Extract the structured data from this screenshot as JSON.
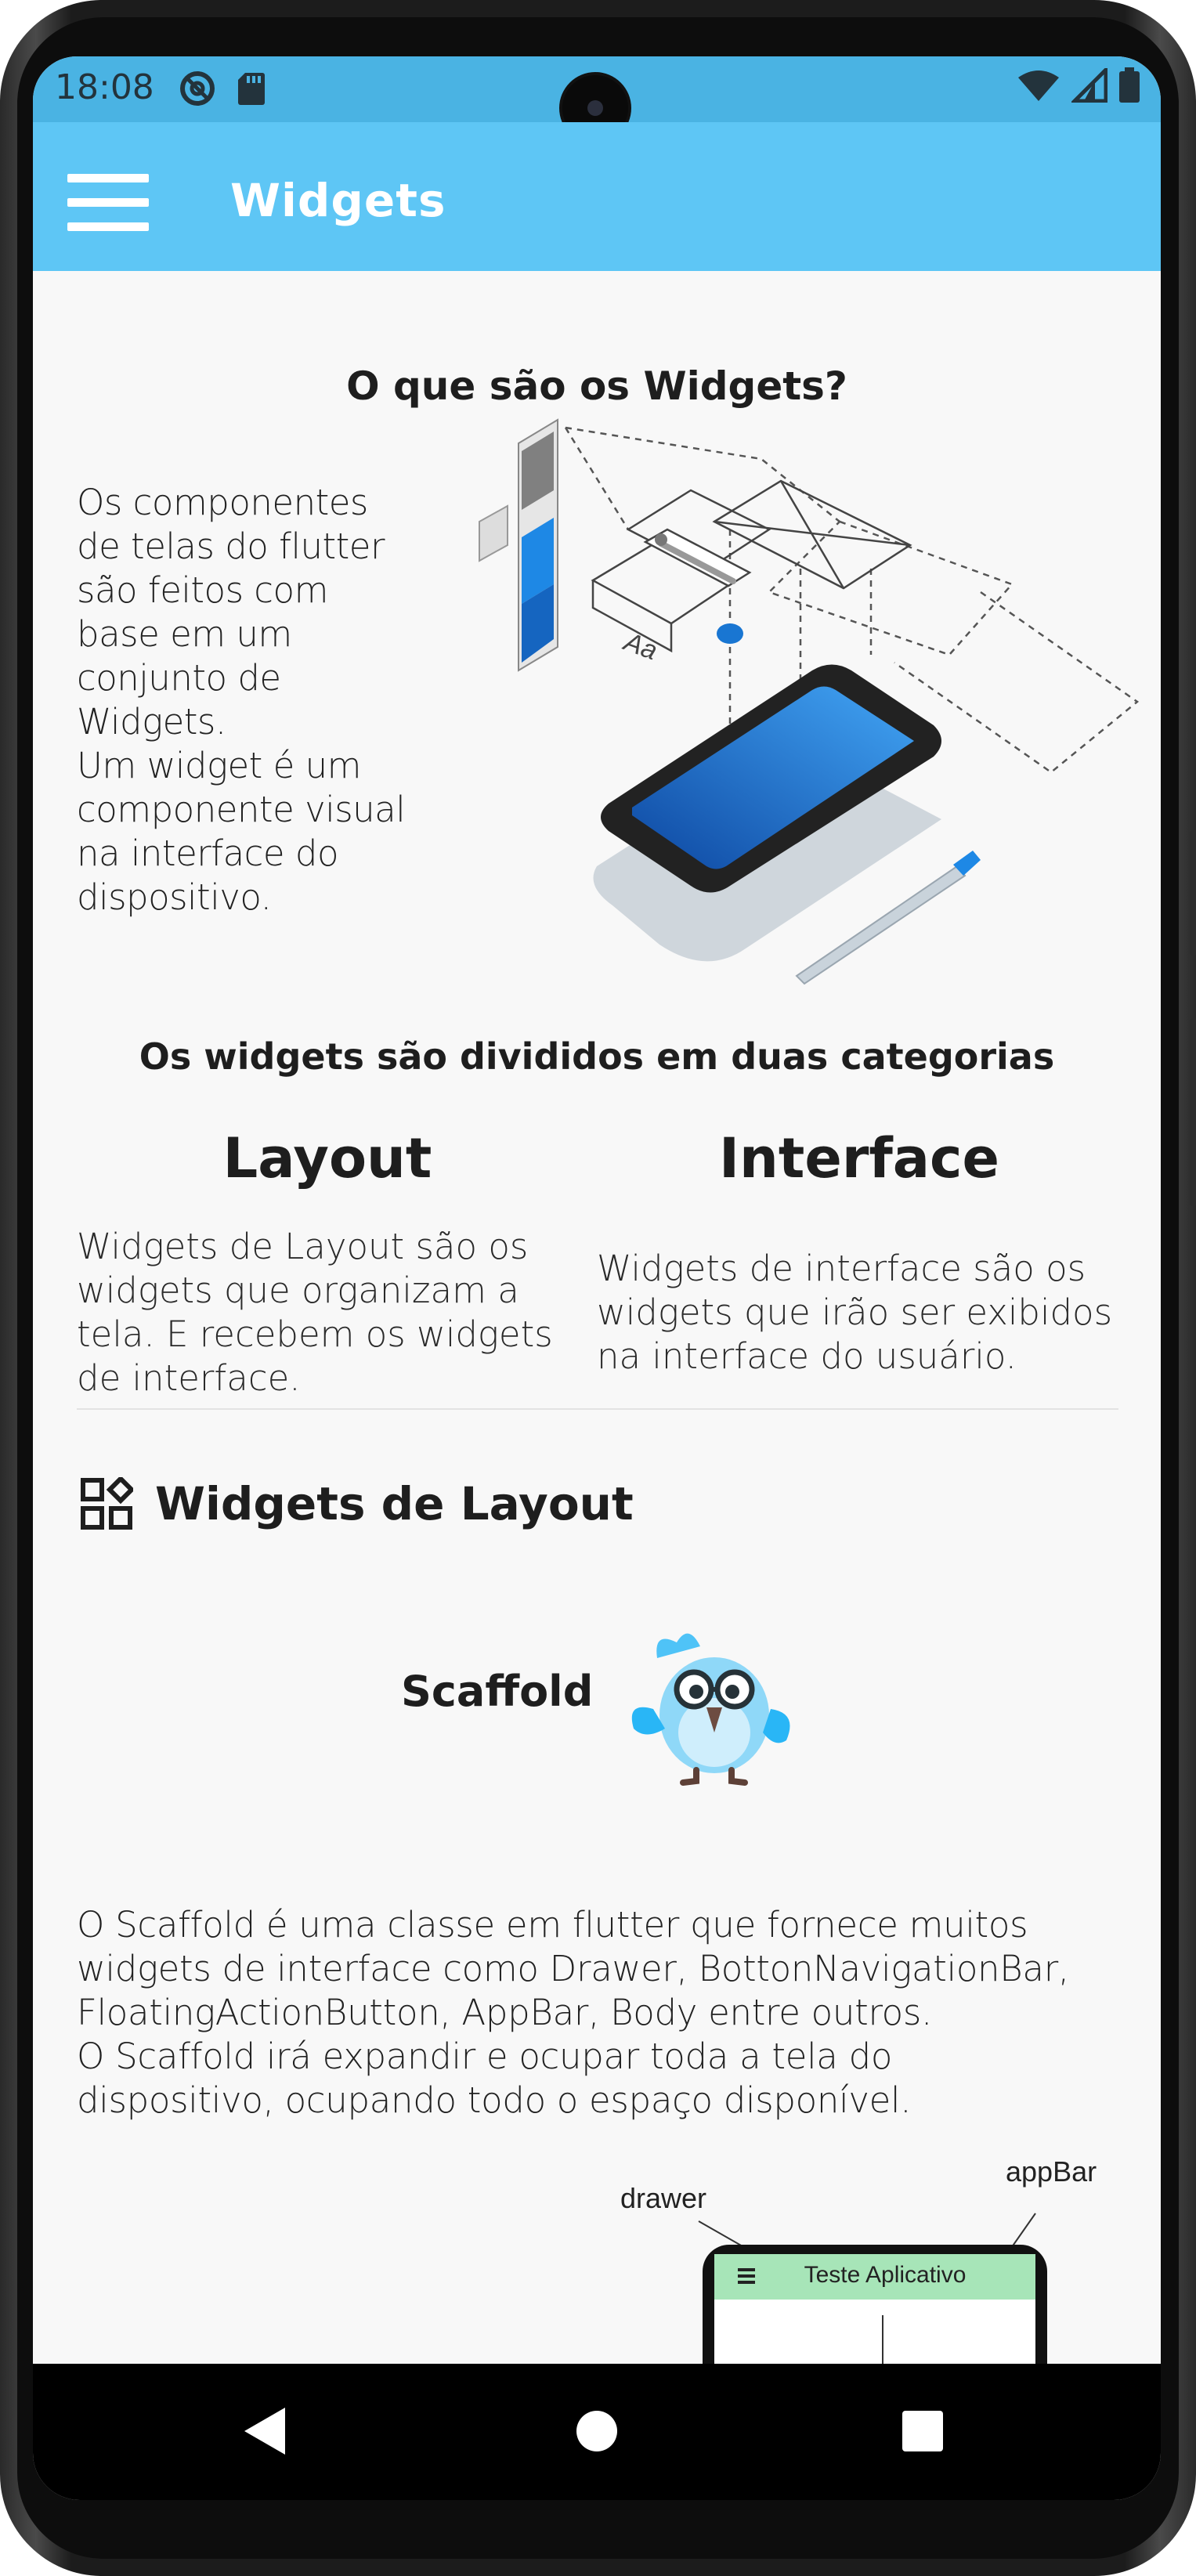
{
  "status_bar": {
    "time": "18:08",
    "left_icons": [
      "do-not-disturb-icon",
      "sd-card-icon"
    ],
    "right_icons": [
      "wifi-icon",
      "signal-icon",
      "battery-icon"
    ]
  },
  "app_bar": {
    "title": "Widgets",
    "menu_icon": "hamburger-menu-icon",
    "background": "#5ec6f5"
  },
  "intro": {
    "title": "O que são os Widgets?",
    "lines": [
      "Os componentes",
      "de telas do flutter",
      "são feitos com",
      "base em um",
      "conjunto de",
      "Widgets.",
      "Um widget é um",
      "componente visual",
      "na interface do",
      "dispositivo."
    ]
  },
  "categories": {
    "title": "Os widgets são divididos em duas categorias",
    "layout": {
      "title": "Layout",
      "lines": [
        "Widgets de Layout são os",
        "widgets que organizam a",
        "tela. E recebem os widgets",
        "de interface."
      ]
    },
    "interface": {
      "title": "Interface",
      "lines": [
        "Widgets de interface são os",
        "widgets que irão ser exibidos",
        "na interface do usuário."
      ]
    }
  },
  "layout_section": {
    "heading": "Widgets de Layout",
    "icon": "widgets-icon"
  },
  "scaffold": {
    "title": "Scaffold",
    "lines": [
      "O Scaffold é uma classe em flutter que fornece muitos",
      "widgets de interface como Drawer, BottonNavigationBar,",
      "FloatingActionButton, AppBar, Body entre outros.",
      "O Scaffold irá expandir e ocupar toda a tela do",
      "dispositivo, ocupando todo o espaço disponível."
    ],
    "diagram": {
      "label_drawer": "drawer",
      "label_appbar": "appBar",
      "phone_title": "Teste Aplicativo"
    }
  },
  "nav_bar": {
    "buttons": [
      "back-icon",
      "home-icon",
      "recent-apps-icon"
    ]
  }
}
